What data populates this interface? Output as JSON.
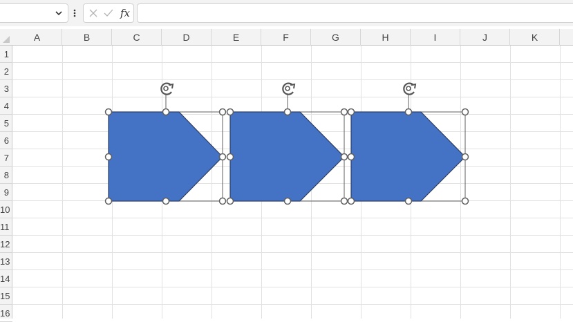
{
  "formula_bar": {
    "name_box_value": "",
    "formula_value": "",
    "function_label": "fx"
  },
  "columns": [
    "A",
    "B",
    "C",
    "D",
    "E",
    "F",
    "G",
    "H",
    "I",
    "J",
    "K"
  ],
  "rows": [
    "1",
    "2",
    "3",
    "4",
    "5",
    "6",
    "7",
    "8",
    "9",
    "10",
    "11",
    "12",
    "13",
    "14",
    "15",
    "16"
  ],
  "shapes": [
    {
      "type": "pentagon-arrow",
      "fill": "#4472c4",
      "outline": "#2f3f63",
      "selected": true
    },
    {
      "type": "pentagon-arrow",
      "fill": "#4472c4",
      "outline": "#2f3f63",
      "selected": true
    },
    {
      "type": "pentagon-arrow",
      "fill": "#4472c4",
      "outline": "#2f3f63",
      "selected": true
    }
  ],
  "colors": {
    "toolbar_bg": "#f3f3f3",
    "gridline": "#e1e1e1",
    "shape_fill": "#4472c4",
    "handle_stroke": "#5f5f5f"
  },
  "icons": [
    "chevron-down-icon",
    "more-options-icon",
    "cancel-icon",
    "enter-icon",
    "insert-function-icon",
    "rotate-handle-icon"
  ]
}
